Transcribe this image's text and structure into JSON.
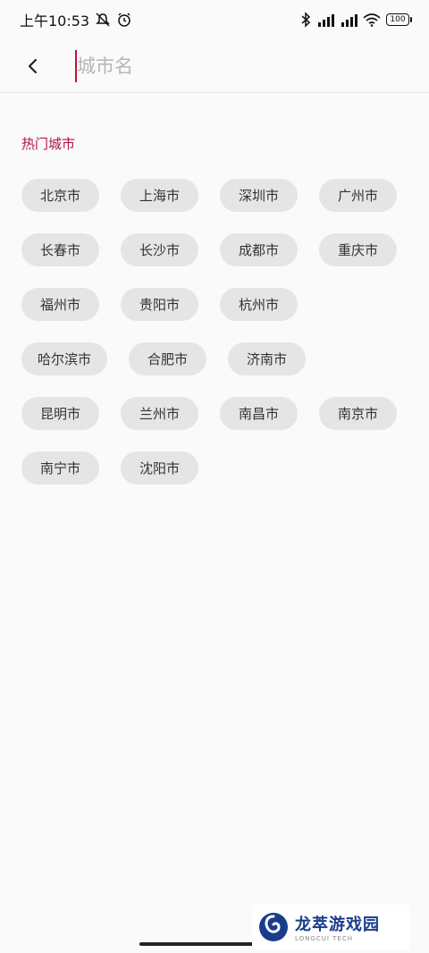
{
  "status": {
    "time": "上午10:53",
    "battery": "100"
  },
  "search": {
    "placeholder": "城市名",
    "value": ""
  },
  "hot": {
    "title": "热门城市",
    "rows": [
      [
        "北京市",
        "上海市",
        "深圳市",
        "广州市"
      ],
      [
        "长春市",
        "长沙市",
        "成都市",
        "重庆市"
      ],
      [
        "福州市",
        "贵阳市",
        "杭州市"
      ],
      [
        "哈尔滨市",
        "合肥市",
        "济南市"
      ],
      [
        "昆明市",
        "兰州市",
        "南昌市",
        "南京市"
      ],
      [
        "南宁市",
        "沈阳市"
      ]
    ]
  },
  "watermark": {
    "title": "龙萃游戏园",
    "subtitle": "LONGCUI TECH"
  },
  "colors": {
    "accent": "#b0163e",
    "chip": "#e5e5e5",
    "background": "#fafafa"
  }
}
